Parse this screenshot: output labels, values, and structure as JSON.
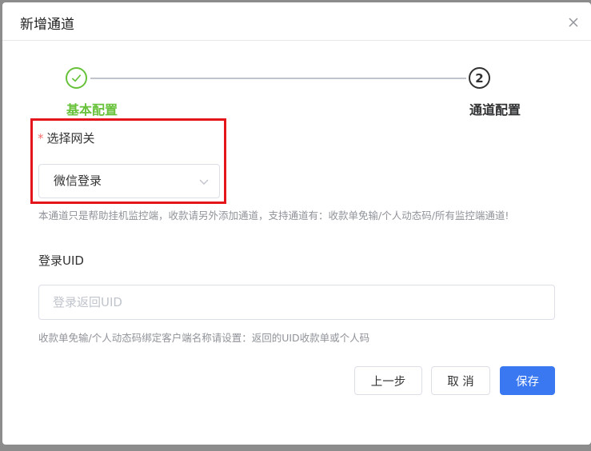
{
  "dialog": {
    "title": "新增通道"
  },
  "steps": [
    {
      "label": "基本配置",
      "status": "finished",
      "number": "1"
    },
    {
      "label": "通道配置",
      "status": "active",
      "number": "2"
    }
  ],
  "form": {
    "gateway": {
      "label": "选择网关",
      "required_mark": "*",
      "value": "微信登录",
      "hint": "本通道只是帮助挂机监控端，收款请另外添加通道，支持通道有：收款单免输/个人动态码/所有监控端通道!"
    },
    "uid": {
      "label": "登录UID",
      "value": "",
      "placeholder": "登录返回UID",
      "hint": "收款单免输/个人动态码绑定客户端名称请设置：返回的UID收款单或个人码"
    }
  },
  "buttons": {
    "prev": "上一步",
    "cancel": "取 消",
    "save": "保存"
  },
  "colors": {
    "primary": "#3a78f2",
    "success": "#67c23a",
    "highlight": "#e4161c",
    "required": "#f56c6c"
  },
  "icons": {
    "close": "close-icon",
    "step_done": "check-icon",
    "select": "chevron-down-icon"
  }
}
